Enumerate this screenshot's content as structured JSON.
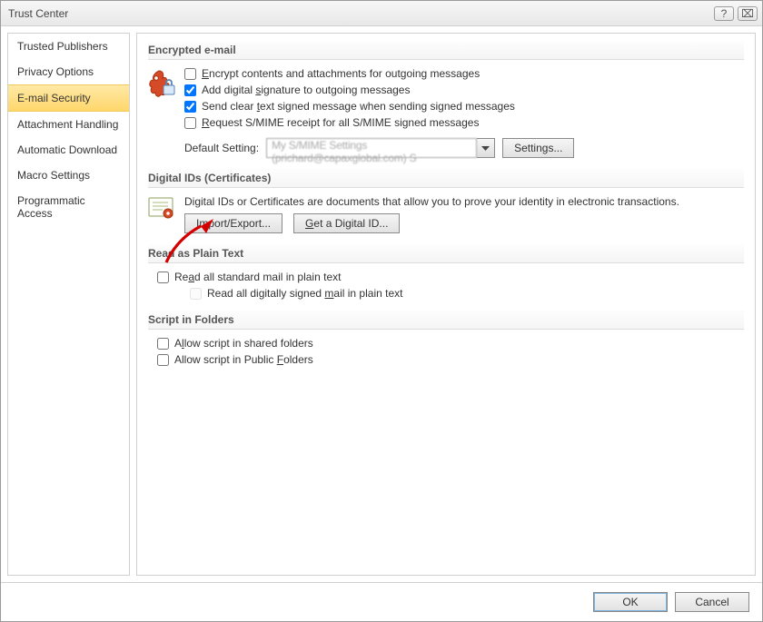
{
  "window": {
    "title": "Trust Center",
    "help": "?",
    "close": "⌧"
  },
  "sidebar": {
    "items": [
      {
        "label": "Trusted Publishers"
      },
      {
        "label": "Privacy Options"
      },
      {
        "label": "E-mail Security",
        "selected": true
      },
      {
        "label": "Attachment Handling"
      },
      {
        "label": "Automatic Download"
      },
      {
        "label": "Macro Settings"
      },
      {
        "label": "Programmatic Access"
      }
    ]
  },
  "encrypted": {
    "heading": "Encrypted e-mail",
    "opts": {
      "encrypt": {
        "pre": "",
        "u": "E",
        "post": "ncrypt contents and attachments for outgoing messages",
        "checked": false
      },
      "sign": {
        "pre": "Add digital ",
        "u": "s",
        "post": "ignature to outgoing messages",
        "checked": true
      },
      "clear": {
        "pre": "Send clear ",
        "u": "t",
        "post": "ext signed message when sending signed messages",
        "checked": true
      },
      "receipt": {
        "pre": "",
        "u": "R",
        "post": "equest S/MIME receipt for all S/MIME signed messages",
        "checked": false
      }
    },
    "default_label": "Default Setting:",
    "default_value": "My S/MIME Settings (prichard@capaxglobal.com) ​S",
    "settings_pre": "Settin",
    "settings_u": "g",
    "settings_post": "s..."
  },
  "digids": {
    "heading": "Digital IDs (Certificates)",
    "para": "Digital IDs or Certificates are documents that allow you to prove your identity in electronic transactions.",
    "import_u": "I",
    "import_post": "mport/Export...",
    "get_u": "G",
    "get_post": "et a Digital ID..."
  },
  "plaintext": {
    "heading": "Read as Plain Text",
    "readall_pre": "Re",
    "readall_u": "a",
    "readall_post": "d all standard mail in plain text",
    "readall_checked": false,
    "readsigned_pre": "Read all digitally signed ",
    "readsigned_u": "m",
    "readsigned_post": "ail in plain text",
    "readsigned_checked": false
  },
  "script": {
    "heading": "Script in Folders",
    "shared_pre": "A",
    "shared_u": "l",
    "shared_post": "low script in shared folders",
    "shared_checked": false,
    "public_pre": "Allow script in Public ",
    "public_u": "F",
    "public_post": "olders",
    "public_checked": false
  },
  "footer": {
    "ok": "OK",
    "cancel": "Cancel"
  }
}
